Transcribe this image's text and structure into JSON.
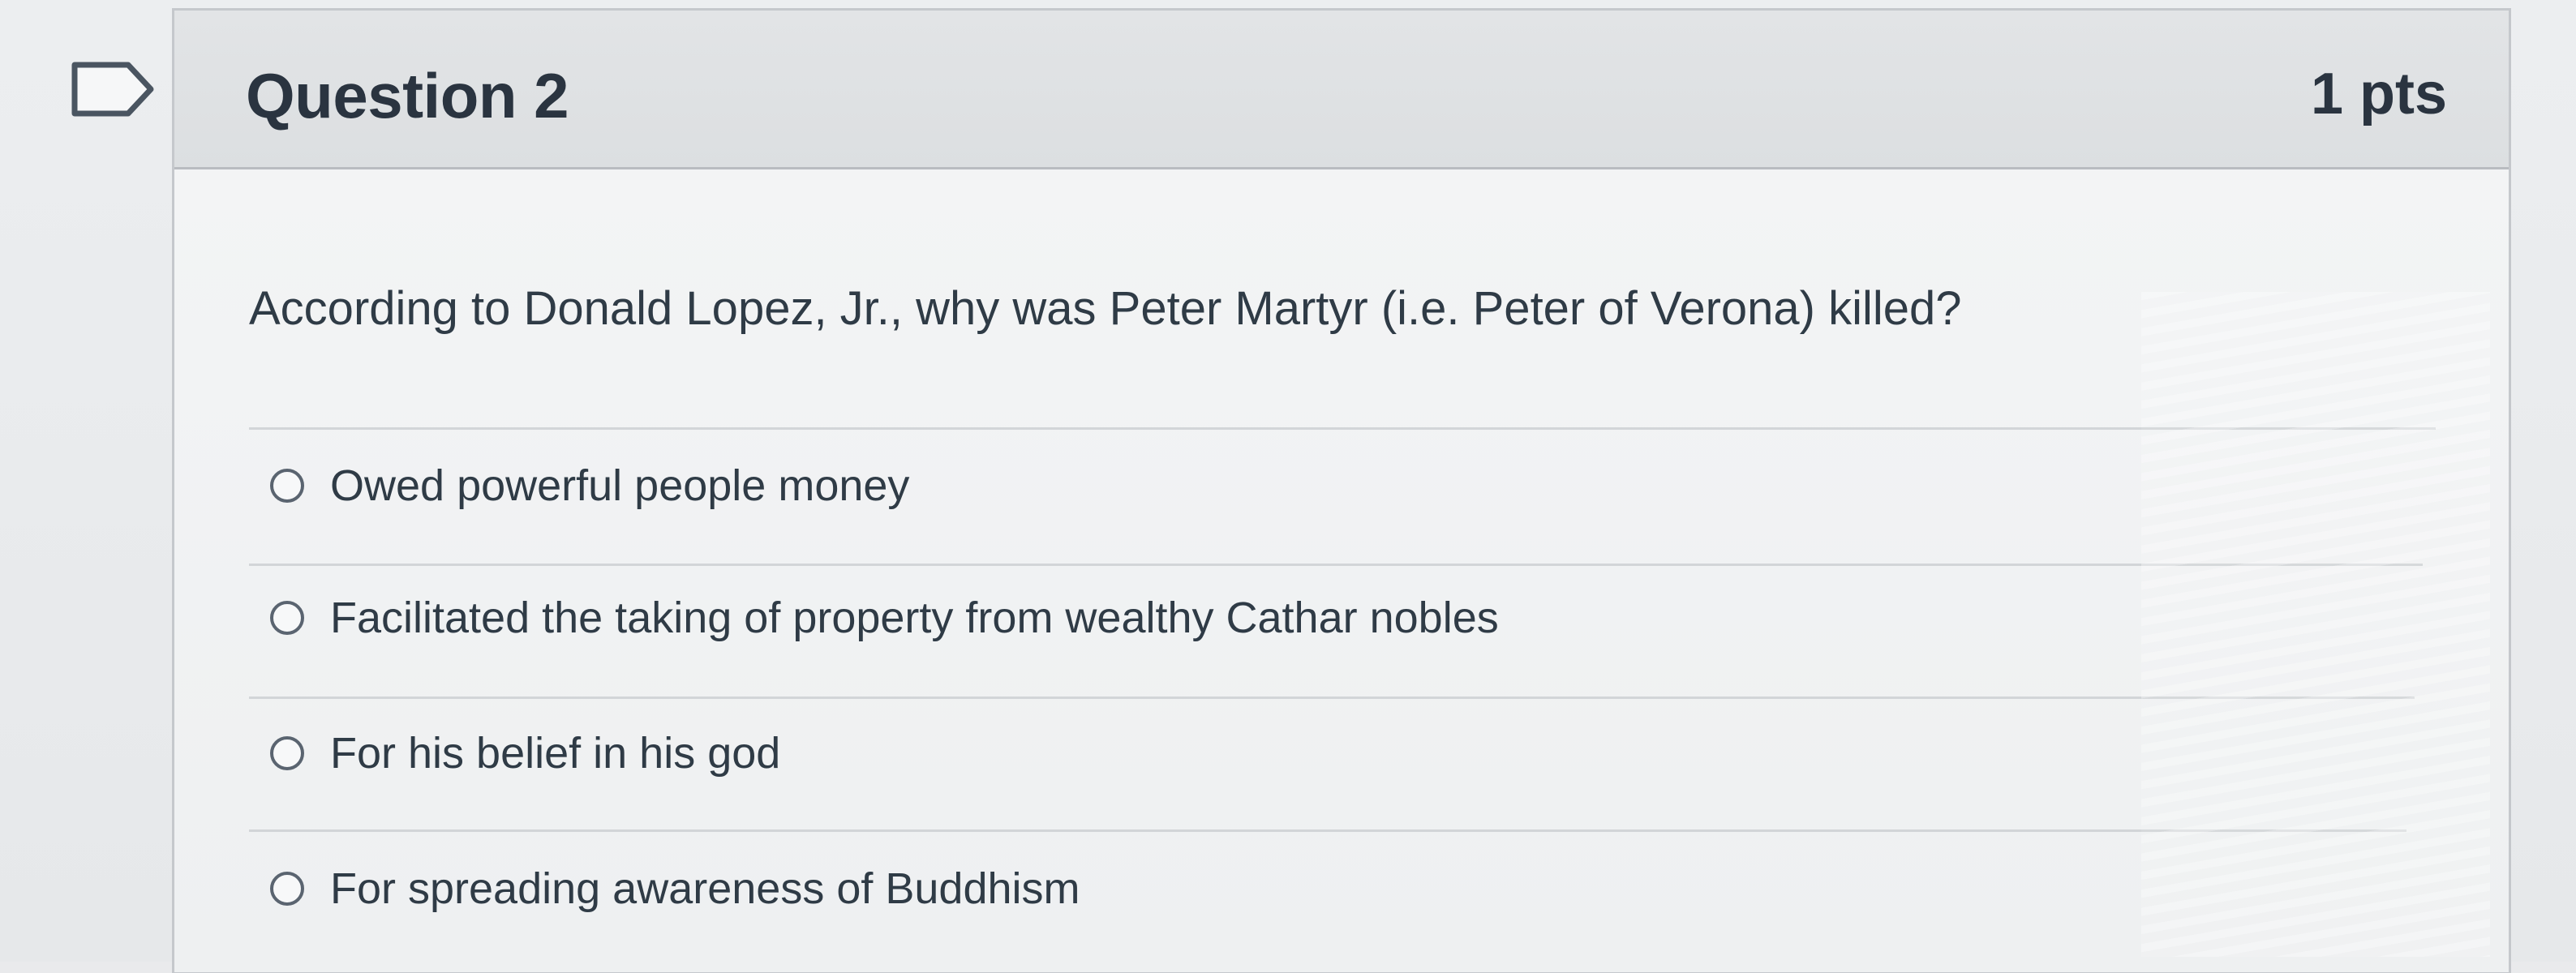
{
  "question": {
    "title": "Question 2",
    "points": "1 pts",
    "text": "According to Donald Lopez, Jr., why was Peter Martyr (i.e. Peter of Verona) killed?",
    "answers": [
      {
        "label": "Owed powerful people money"
      },
      {
        "label": "Facilitated the taking of property from wealthy Cathar nobles"
      },
      {
        "label": "For his belief in his god"
      },
      {
        "label": "For spreading awareness of Buddhism"
      }
    ]
  },
  "icons": {
    "flag": "bookmark-flag-icon",
    "radio": "radio-unselected-icon"
  },
  "colors": {
    "header_bg": "#dcdfe1",
    "body_bg": "#f3f4f5",
    "text": "#2f3b46",
    "border": "#c5c8cc"
  }
}
